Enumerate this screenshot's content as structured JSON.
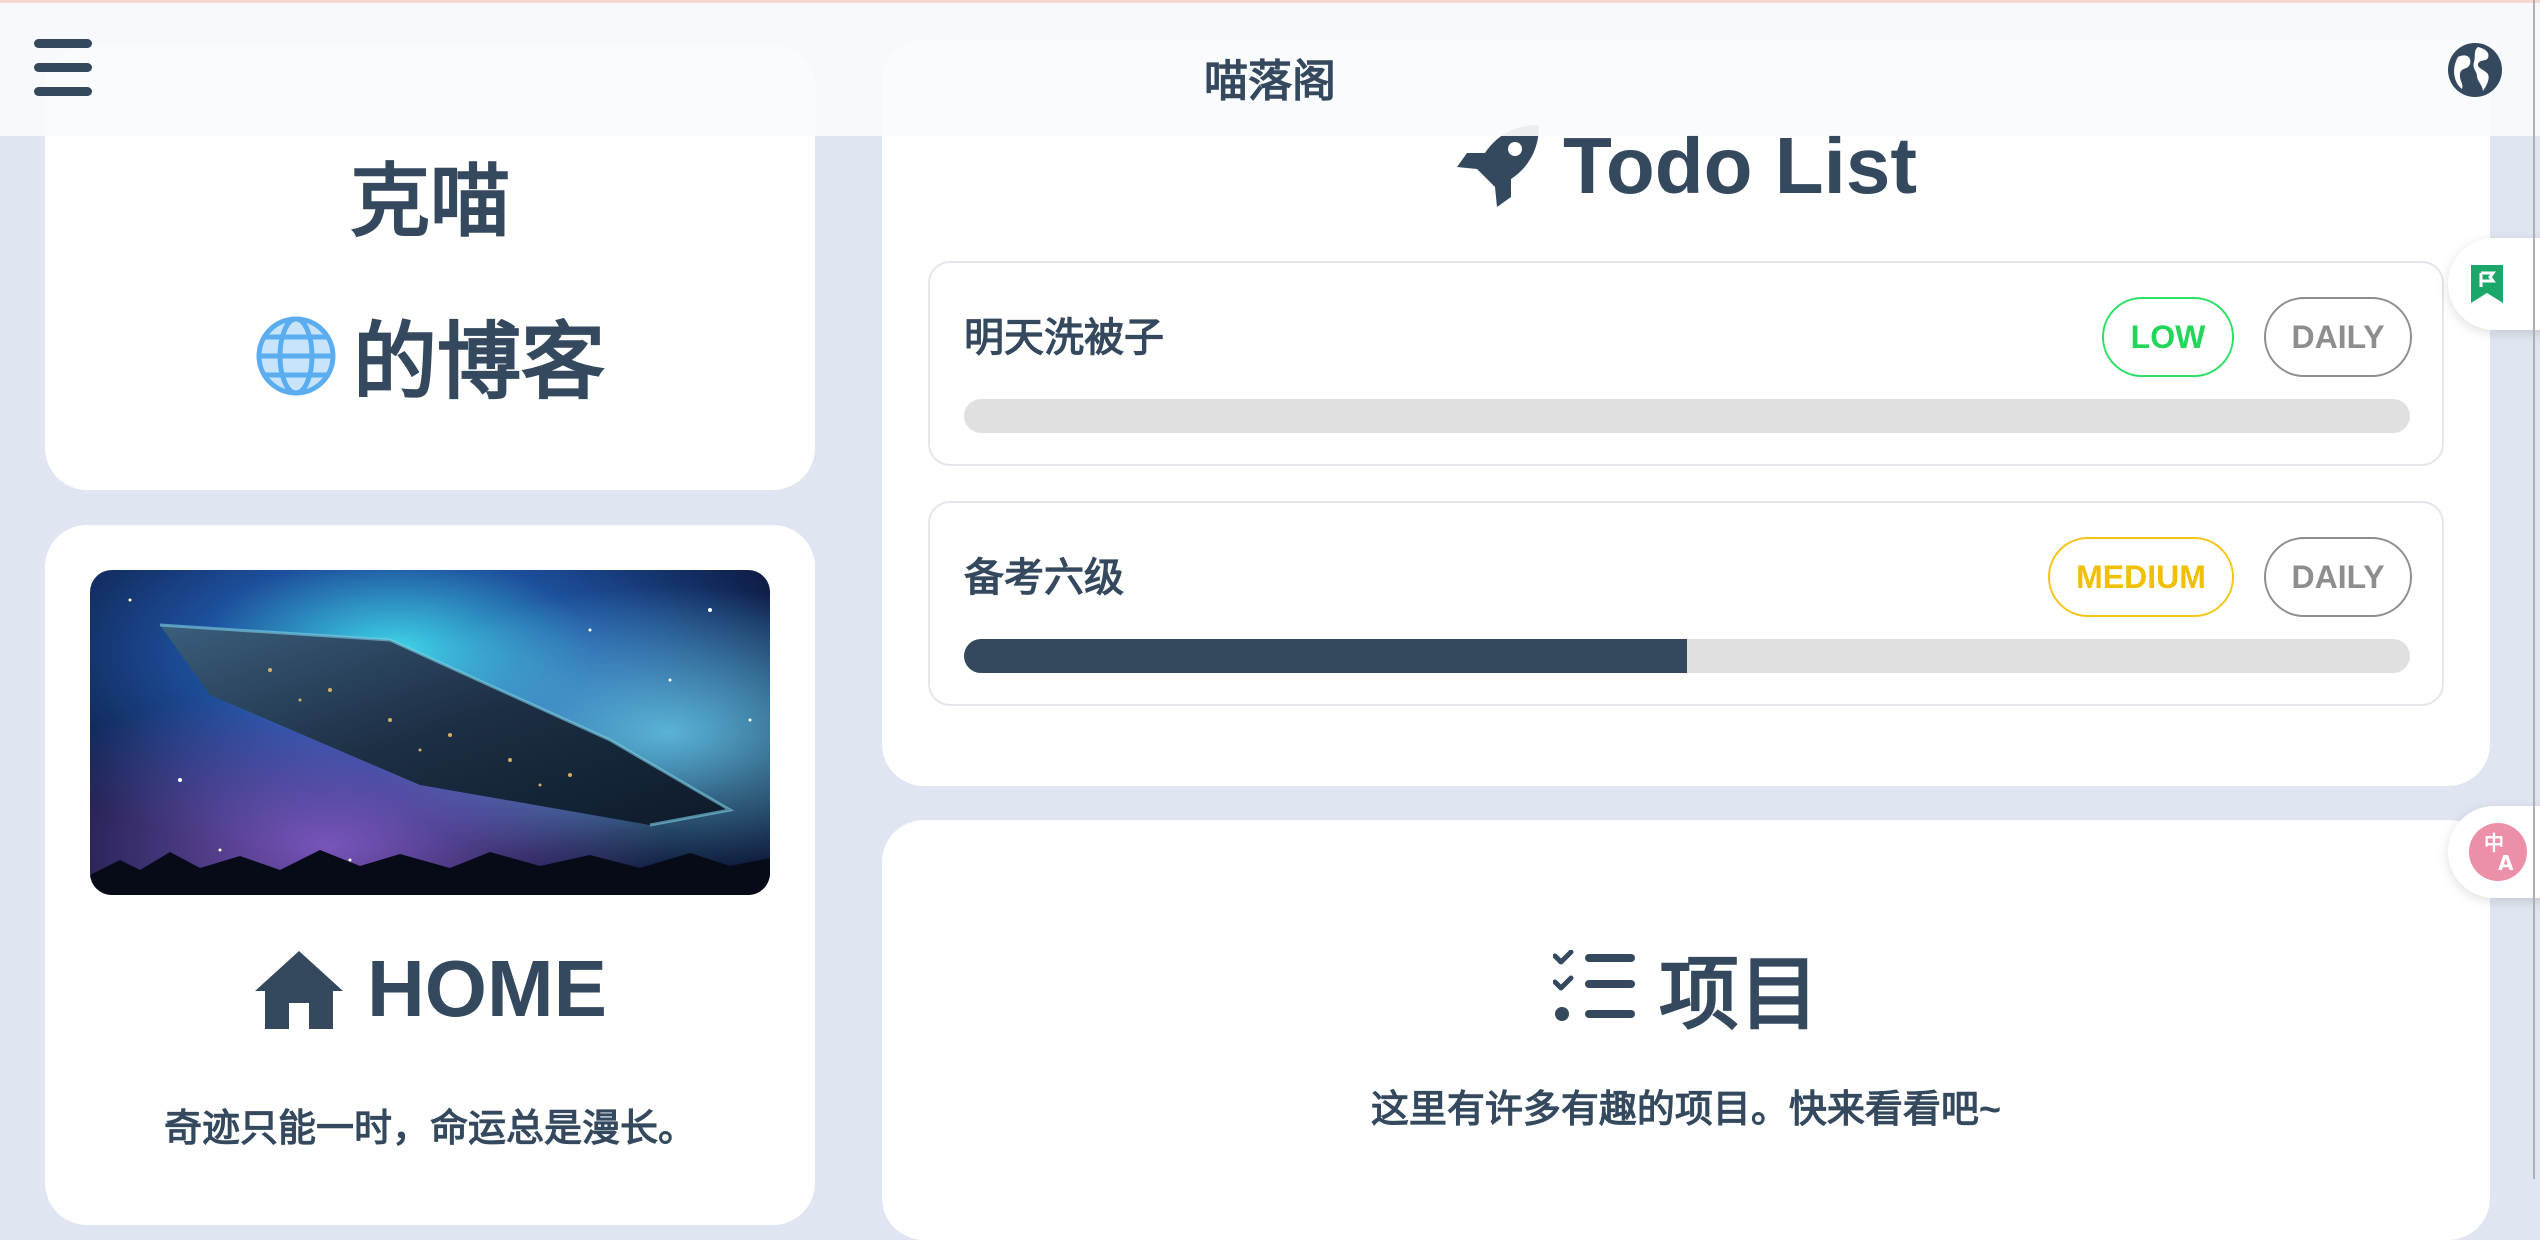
{
  "header": {
    "site_title": "喵落阁",
    "menu_icon": "hamburger-menu-icon",
    "language_icon": "globe-icon"
  },
  "profile": {
    "name": "克喵",
    "blog_suffix": "的博客",
    "globe_icon": "globe-icon"
  },
  "home": {
    "banner_image": "sci-fi spaceship in nebula",
    "title": "HOME",
    "icon": "house-icon",
    "motto": "奇迹只能一时，命运总是漫长。"
  },
  "todo": {
    "title": "Todo List",
    "icon": "rocket-icon",
    "items": [
      {
        "name": "明天洗被子",
        "priority": "LOW",
        "frequency": "DAILY",
        "progress": 0
      },
      {
        "name": "备考六级",
        "priority": "MEDIUM",
        "frequency": "DAILY",
        "progress": 0.5
      }
    ]
  },
  "projects": {
    "title": "项目",
    "icon": "checklist-icon",
    "description": "这里有许多有趣的项目。快来看看吧~"
  },
  "side_buttons": {
    "bookmark_icon": "bookmark-icon",
    "translate_icon": "translate-icon"
  },
  "colors": {
    "primary": "#34495e",
    "background": "#dfe5f1",
    "low": "#23d65a",
    "medium": "#f0c000",
    "daily": "#8e8e8e",
    "bookmark": "#1aa86a",
    "translate": "#ec8fa8"
  }
}
